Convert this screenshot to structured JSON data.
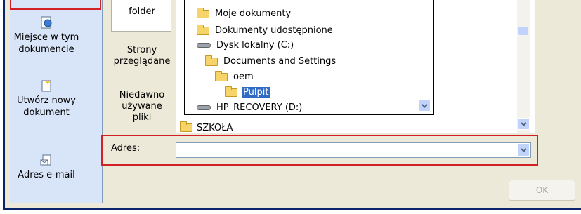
{
  "linkbar": {
    "items": [
      {
        "label_line1": "Miejsce w tym",
        "label_line2": "dokumencie"
      },
      {
        "label_line1": "Utwórz nowy",
        "label_line2": "dokument"
      },
      {
        "label_line1": "Adres e-mail",
        "label_line2": ""
      }
    ]
  },
  "lookbar": {
    "items": [
      {
        "label_line1": "folder",
        "label_line2": "",
        "label_line3": ""
      },
      {
        "label_line1": "Strony",
        "label_line2": "przeglądane",
        "label_line3": ""
      },
      {
        "label_line1": "Niedawno",
        "label_line2": "używane",
        "label_line3": "pliki"
      }
    ]
  },
  "tree": {
    "items": [
      {
        "label": "Moje dokumenty",
        "icon": "folder-icon"
      },
      {
        "label": "Dokumenty udostępnione",
        "icon": "folder-icon"
      },
      {
        "label": "Dysk lokalny (C:)",
        "icon": "drive-icon"
      },
      {
        "label": "Documents and Settings",
        "icon": "folder-icon"
      },
      {
        "label": "oem",
        "icon": "folder-icon"
      },
      {
        "label": "Pulpit",
        "icon": "folder-icon",
        "selected": true
      },
      {
        "label": "HP_RECOVERY (D:)",
        "icon": "drive-icon"
      }
    ]
  },
  "filelist": {
    "visible_item": "SZKOŁA"
  },
  "address": {
    "label": "Adres:",
    "value": ""
  },
  "ok_button": {
    "label": "OK"
  },
  "colors": {
    "highlight_red": "#d32027",
    "selection_blue": "#316ac5",
    "frame_blue": "#0a246a"
  }
}
